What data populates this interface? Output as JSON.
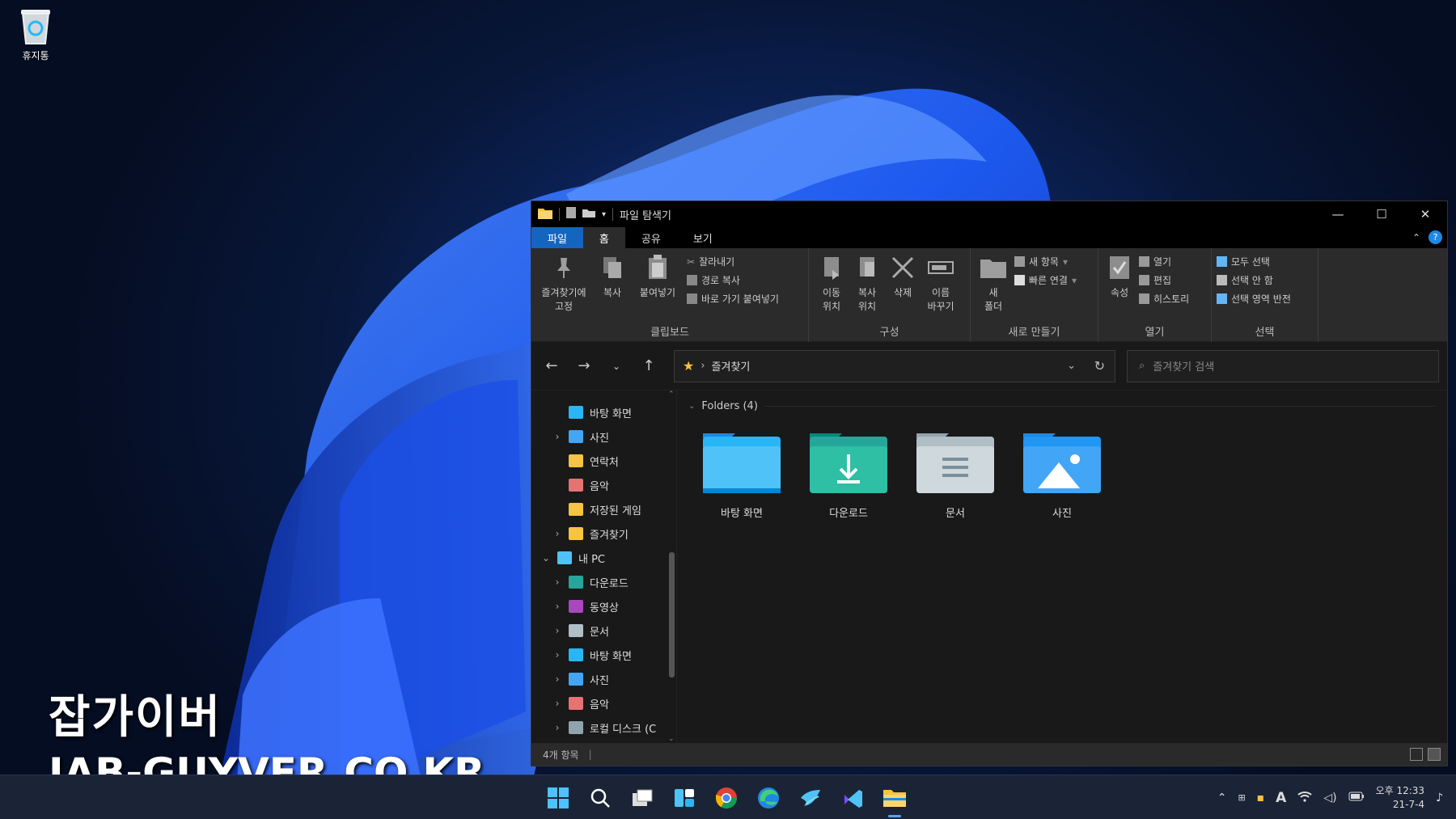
{
  "desktop": {
    "recycle_bin_label": "휴지통",
    "watermark_title": "잡가이버",
    "watermark_url": "JAB-GUYVER.CO.KR"
  },
  "window": {
    "title": "파일 탐색기",
    "tabs": [
      "파일",
      "홈",
      "공유",
      "보기"
    ],
    "active_tab": "홈"
  },
  "ribbon": {
    "clipboard": {
      "label": "클립보드",
      "pin": "즐겨찾기에\n고정",
      "copy": "복사",
      "paste": "붙여넣기",
      "cut": "잘라내기",
      "copy_path": "경로 복사",
      "paste_shortcut": "바로 가기 붙여넣기"
    },
    "organize": {
      "label": "구성",
      "move_to": "이동\n위치",
      "copy_to": "복사\n위치",
      "delete": "삭제",
      "rename": "이름\n바꾸기"
    },
    "new": {
      "label": "새로 만들기",
      "new_folder": "새\n폴더",
      "new_item": "새 항목",
      "easy_access": "빠른 연결"
    },
    "open": {
      "label": "열기",
      "properties": "속성",
      "open": "열기",
      "edit": "편집",
      "history": "히스토리"
    },
    "select": {
      "label": "선택",
      "select_all": "모두 선택",
      "select_none": "선택 안 함",
      "invert": "선택 영역 반전"
    }
  },
  "address": {
    "path": "즐겨찾기",
    "search_placeholder": "즐겨찾기 검색"
  },
  "navpane": [
    {
      "label": "바탕 화면",
      "indent": 1,
      "chev": "",
      "color": "#29b6f6"
    },
    {
      "label": "사진",
      "indent": 1,
      "chev": "›",
      "color": "#42a5f5"
    },
    {
      "label": "연락처",
      "indent": 1,
      "chev": "",
      "color": "#f6c343"
    },
    {
      "label": "음악",
      "indent": 1,
      "chev": "",
      "color": "#e57373"
    },
    {
      "label": "저장된 게임",
      "indent": 1,
      "chev": "",
      "color": "#f6c343"
    },
    {
      "label": "즐겨찾기",
      "indent": 1,
      "chev": "›",
      "color": "#f6c343"
    },
    {
      "label": "내 PC",
      "indent": 0,
      "chev": "⌄",
      "color": "#4fc3f7"
    },
    {
      "label": "다운로드",
      "indent": 1,
      "chev": "›",
      "color": "#26a69a"
    },
    {
      "label": "동영상",
      "indent": 1,
      "chev": "›",
      "color": "#ab47bc"
    },
    {
      "label": "문서",
      "indent": 1,
      "chev": "›",
      "color": "#b0bec5"
    },
    {
      "label": "바탕 화면",
      "indent": 1,
      "chev": "›",
      "color": "#29b6f6"
    },
    {
      "label": "사진",
      "indent": 1,
      "chev": "›",
      "color": "#42a5f5"
    },
    {
      "label": "음악",
      "indent": 1,
      "chev": "›",
      "color": "#e57373"
    },
    {
      "label": "로컬 디스크 (C",
      "indent": 1,
      "chev": "›",
      "color": "#90a4ae"
    }
  ],
  "main": {
    "group_header": "Folders (4)",
    "folders": [
      {
        "label": "바탕 화면",
        "type": "desktop"
      },
      {
        "label": "다운로드",
        "type": "downloads"
      },
      {
        "label": "문서",
        "type": "documents"
      },
      {
        "label": "사진",
        "type": "pictures"
      }
    ]
  },
  "status": {
    "count": "4개 항목"
  },
  "tray": {
    "ime": "A",
    "time": "오후 12:33",
    "date": "21-7-4"
  }
}
